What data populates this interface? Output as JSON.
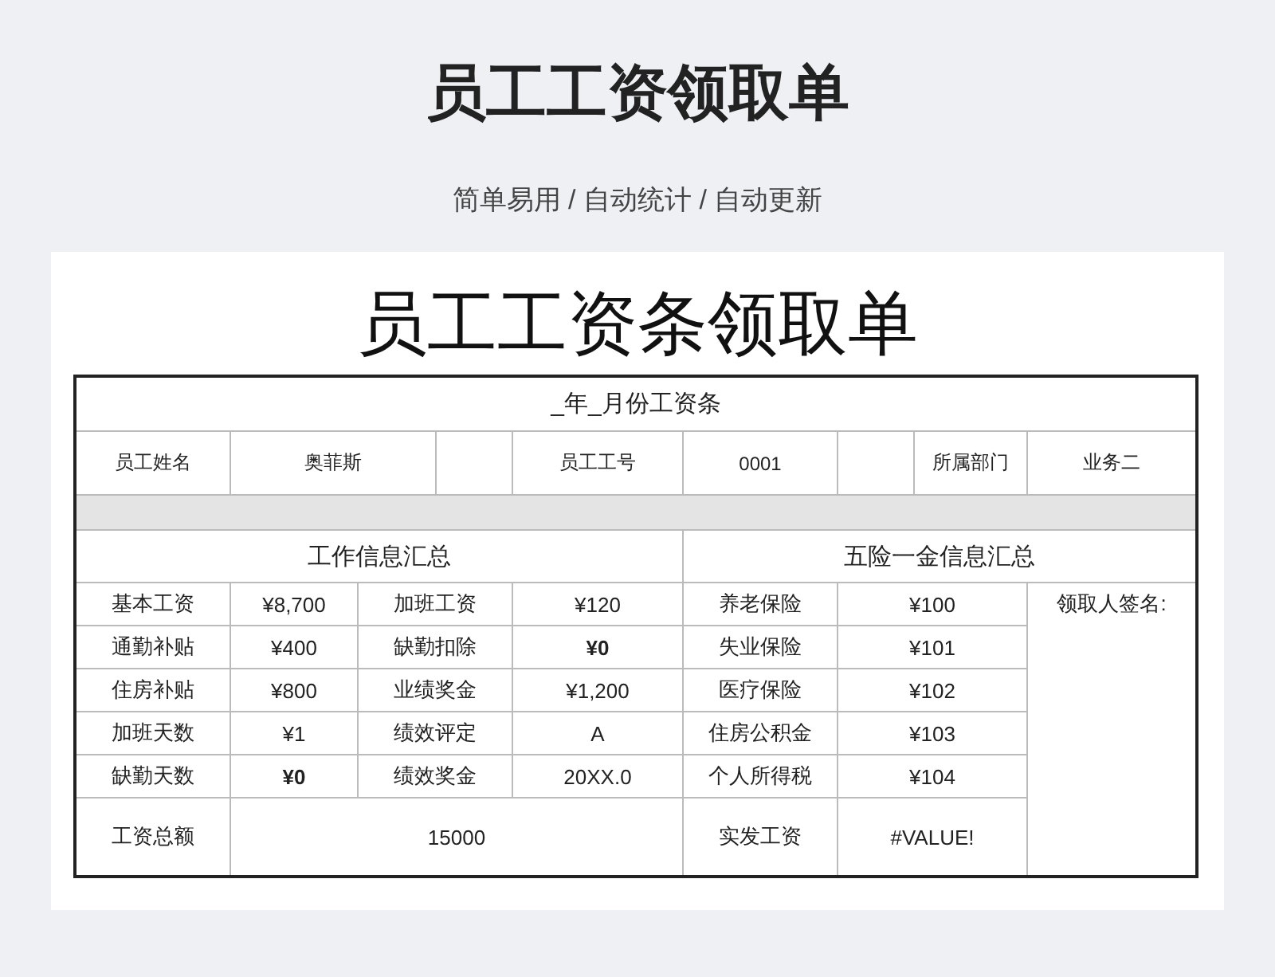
{
  "page_title": "员工工资领取单",
  "subtitle": "简单易用 / 自动统计 / 自动更新",
  "sheet": {
    "title": "员工工资条领取单",
    "period": "_年_月份工资条",
    "info": [
      {
        "label": "员工姓名",
        "value": "奥菲斯"
      },
      {
        "label": "员工工号",
        "value": "0001"
      },
      {
        "label": "所属部门",
        "value": "业务二"
      }
    ],
    "work_section": "工作信息汇总",
    "insurance_section": "五险一金信息汇总",
    "rows": [
      {
        "label_1": "基本工资",
        "value_1": "¥8,700",
        "value_1_bold": false,
        "label_2": "加班工资",
        "value_2": "¥120",
        "value_2_bold": false,
        "insurance": "养老保险",
        "amount": "¥100"
      },
      {
        "label_1": "通勤补贴",
        "value_1": "¥400",
        "value_1_bold": false,
        "label_2": "缺勤扣除",
        "value_2": "¥0",
        "value_2_bold": true,
        "insurance": "失业保险",
        "amount": "¥101"
      },
      {
        "label_1": "住房补贴",
        "value_1": "¥800",
        "value_1_bold": false,
        "label_2": "业绩奖金",
        "value_2": "¥1,200",
        "value_2_bold": false,
        "insurance": "医疗保险",
        "amount": "¥102"
      },
      {
        "label_1": "加班天数",
        "value_1": "¥1",
        "value_1_bold": false,
        "label_2": "绩效评定",
        "value_2": "A",
        "value_2_bold": false,
        "insurance": "住房公积金",
        "amount": "¥103"
      },
      {
        "label_1": "缺勤天数",
        "value_1": "¥0",
        "value_1_bold": true,
        "label_2": "绩效奖金",
        "value_2": "20XX.0",
        "value_2_bold": false,
        "insurance": "个人所得税",
        "amount": "¥104"
      }
    ],
    "total_label": "工资总额",
    "total_value": "15000",
    "net_label": "实发工资",
    "net_value": "#VALUE!",
    "signature_label": "领取人签名:"
  }
}
